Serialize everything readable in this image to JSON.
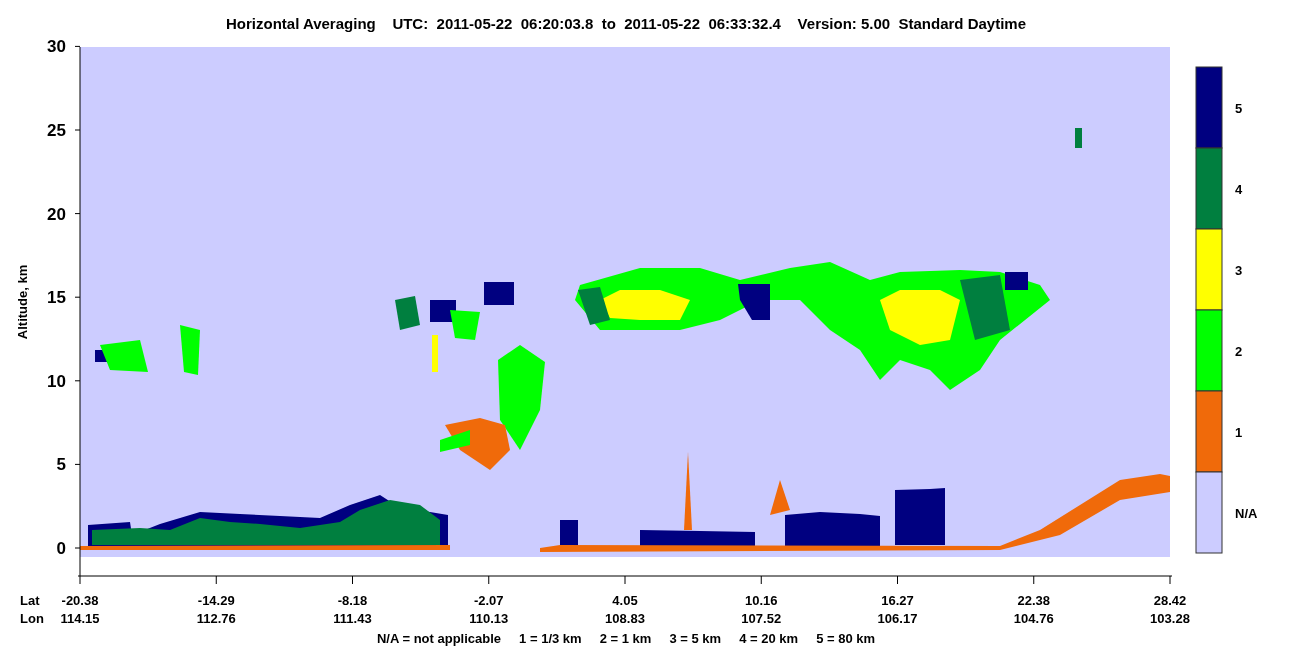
{
  "title": "Horizontal Averaging    UTC:  2011-05-22  06:20:03.8  to  2011-05-22  06:33:32.4    Version: 5.00  Standard Daytime",
  "y_axis": {
    "label": "Altitude, km",
    "ticks": [
      "30",
      "25",
      "20",
      "15",
      "10",
      "5",
      "0"
    ]
  },
  "x_axis": {
    "row_labels": [
      "Lat",
      "Lon"
    ],
    "ticks": [
      {
        "lat": "-20.38",
        "lon": "114.15"
      },
      {
        "lat": "-14.29",
        "lon": "112.76"
      },
      {
        "lat": "-8.18",
        "lon": "111.43"
      },
      {
        "lat": "-2.07",
        "lon": "110.13"
      },
      {
        "lat": "4.05",
        "lon": "108.83"
      },
      {
        "lat": "10.16",
        "lon": "107.52"
      },
      {
        "lat": "16.27",
        "lon": "106.17"
      },
      {
        "lat": "22.38",
        "lon": "104.76"
      },
      {
        "lat": "28.42",
        "lon": "103.28"
      }
    ]
  },
  "legend": [
    {
      "label": "5",
      "color": "#000080"
    },
    {
      "label": "4",
      "color": "#007f3f"
    },
    {
      "label": "3",
      "color": "#ffff00"
    },
    {
      "label": "2",
      "color": "#00ff00"
    },
    {
      "label": "1",
      "color": "#f06a0a"
    },
    {
      "label": "N/A",
      "color": "#ccccff"
    }
  ],
  "footnote": "N/A = not applicable     1 = 1/3 km     2 = 1 km     3 = 5 km     4 = 20 km     5 = 80 km"
}
